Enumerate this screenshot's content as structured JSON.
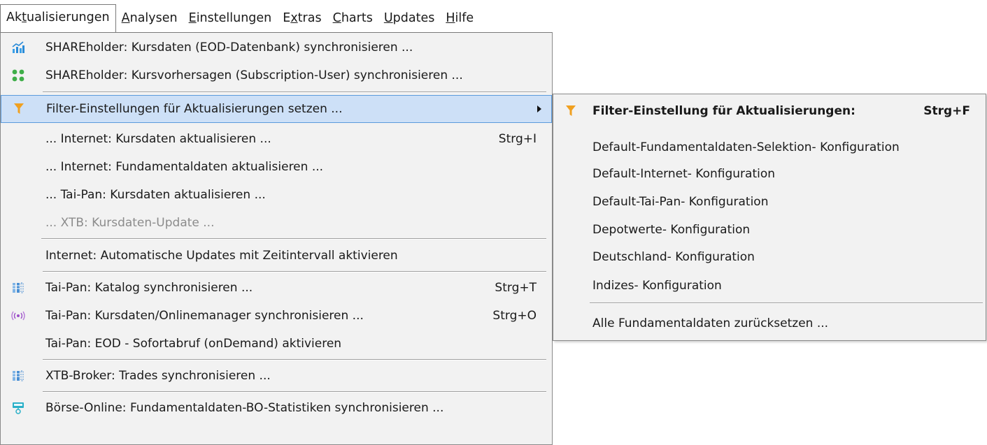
{
  "menubar": {
    "items": [
      {
        "pre": "Ak",
        "ul": "t",
        "post": "ualisierungen"
      },
      {
        "pre": "",
        "ul": "A",
        "post": "nalysen"
      },
      {
        "pre": "",
        "ul": "E",
        "post": "instellungen"
      },
      {
        "pre": "E",
        "ul": "x",
        "post": "tras"
      },
      {
        "pre": "",
        "ul": "C",
        "post": "harts"
      },
      {
        "pre": "",
        "ul": "U",
        "post": "pdates"
      },
      {
        "pre": "",
        "ul": "H",
        "post": "ilfe"
      }
    ]
  },
  "menu": {
    "items": [
      {
        "label": "SHAREholder: Kursdaten (EOD-Datenbank) synchronisieren ...",
        "shortcut": "",
        "icon": "bar-chart-icon"
      },
      {
        "label": "SHAREholder: Kursvorhersagen (Subscription-User) synchronisieren ...",
        "shortcut": "",
        "icon": "grid-dots-icon"
      },
      {
        "label": "Filter-Einstellungen für Aktualisierungen setzen ...",
        "shortcut": "",
        "icon": "filter-icon"
      },
      {
        "label": "... Internet: Kursdaten aktualisieren ...",
        "shortcut": "Strg+I",
        "icon": ""
      },
      {
        "label": "... Internet: Fundamentaldaten aktualisieren ...",
        "shortcut": "",
        "icon": ""
      },
      {
        "label": "... Tai-Pan: Kursdaten aktualisieren ...",
        "shortcut": "",
        "icon": ""
      },
      {
        "label": "... XTB: Kursdaten-Update ...",
        "shortcut": "",
        "icon": ""
      },
      {
        "label": "Internet: Automatische Updates mit Zeitintervall aktivieren",
        "shortcut": "",
        "icon": ""
      },
      {
        "label": "Tai-Pan: Katalog synchronisieren ...",
        "shortcut": "Strg+T",
        "icon": "catalog-icon"
      },
      {
        "label": "Tai-Pan: Kursdaten/Onlinemanager synchronisieren ...",
        "shortcut": "Strg+O",
        "icon": "broadcast-icon"
      },
      {
        "label": "Tai-Pan: EOD - Sofortabruf (onDemand) aktivieren",
        "shortcut": "",
        "icon": ""
      },
      {
        "label": "XTB-Broker: Trades synchronisieren ...",
        "shortcut": "",
        "icon": "catalog-icon"
      },
      {
        "label": "Börse-Online: Fundamentaldaten-BO-Statistiken synchronisieren ...",
        "shortcut": "",
        "icon": "monitor-icon"
      }
    ]
  },
  "submenu": {
    "header_label": "Filter-Einstellung für Aktualisierungen:",
    "header_shortcut": "Strg+F",
    "items": [
      "Default-Fundamentaldaten-Selektion- Konfiguration",
      "Default-Internet- Konfiguration",
      "Default-Tai-Pan- Konfiguration",
      "Depotwerte- Konfiguration",
      "Deutschland- Konfiguration",
      "Indizes- Konfiguration"
    ],
    "reset_label": "Alle Fundamentaldaten zurücksetzen ..."
  },
  "colors": {
    "highlight_bg": "#cde0f7",
    "highlight_border": "#5b9bdc",
    "filter_icon": "#f0a020",
    "menu_bg": "#f2f2f2"
  }
}
